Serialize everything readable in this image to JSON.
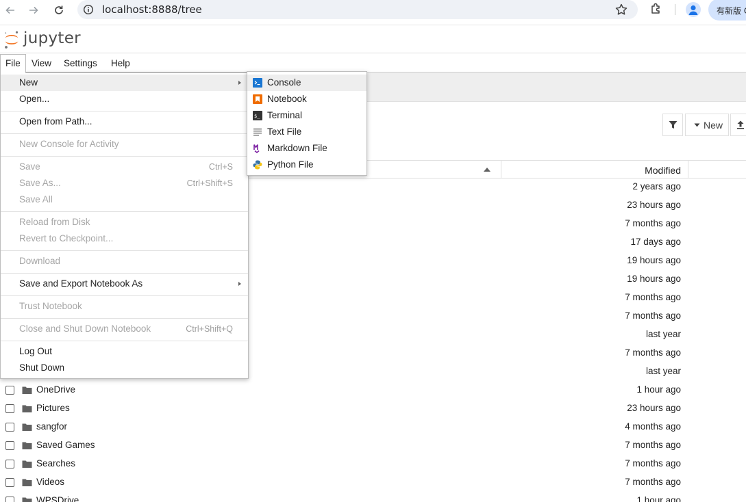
{
  "browser": {
    "url": "localhost:8888/tree",
    "update_label": "有新版 C"
  },
  "app": {
    "wordmark": "jupyter",
    "accent": "#f37726"
  },
  "menubar": [
    {
      "label": "File",
      "active": true
    },
    {
      "label": "View"
    },
    {
      "label": "Settings"
    },
    {
      "label": "Help"
    }
  ],
  "toolbar": {
    "new_label": "New"
  },
  "file_list": {
    "modified_header": "Modified",
    "rows": [
      {
        "name": "",
        "modified": "2 years ago"
      },
      {
        "name": "",
        "modified": "23 hours ago"
      },
      {
        "name": "",
        "modified": "7 months ago"
      },
      {
        "name": "",
        "modified": "17 days ago"
      },
      {
        "name": "",
        "modified": "19 hours ago"
      },
      {
        "name": "",
        "modified": "19 hours ago"
      },
      {
        "name": "",
        "modified": "7 months ago"
      },
      {
        "name": "",
        "modified": "7 months ago"
      },
      {
        "name": "",
        "modified": "last year"
      },
      {
        "name": "",
        "modified": "7 months ago"
      },
      {
        "name": "",
        "modified": "last year"
      },
      {
        "name": "OneDrive",
        "modified": "1 hour ago"
      },
      {
        "name": "Pictures",
        "modified": "23 hours ago"
      },
      {
        "name": "sangfor",
        "modified": "4 months ago"
      },
      {
        "name": "Saved Games",
        "modified": "7 months ago"
      },
      {
        "name": "Searches",
        "modified": "7 months ago"
      },
      {
        "name": "Videos",
        "modified": "7 months ago"
      },
      {
        "name": "WPSDrive",
        "modified": "1 hour ago"
      }
    ]
  },
  "file_menu": {
    "new": "New",
    "open": "Open...",
    "open_from_path": "Open from Path...",
    "new_console_activity": "New Console for Activity",
    "save": "Save",
    "save_shortcut": "Ctrl+S",
    "save_as": "Save As...",
    "save_as_shortcut": "Ctrl+Shift+S",
    "save_all": "Save All",
    "reload": "Reload from Disk",
    "revert": "Revert to Checkpoint...",
    "download": "Download",
    "save_export": "Save and Export Notebook As",
    "trust": "Trust Notebook",
    "close_shutdown": "Close and Shut Down Notebook",
    "close_shutdown_shortcut": "Ctrl+Shift+Q",
    "logout": "Log Out",
    "shutdown": "Shut Down"
  },
  "new_submenu": {
    "console": "Console",
    "notebook": "Notebook",
    "terminal": "Terminal",
    "text_file": "Text File",
    "markdown_file": "Markdown File",
    "python_file": "Python File"
  }
}
